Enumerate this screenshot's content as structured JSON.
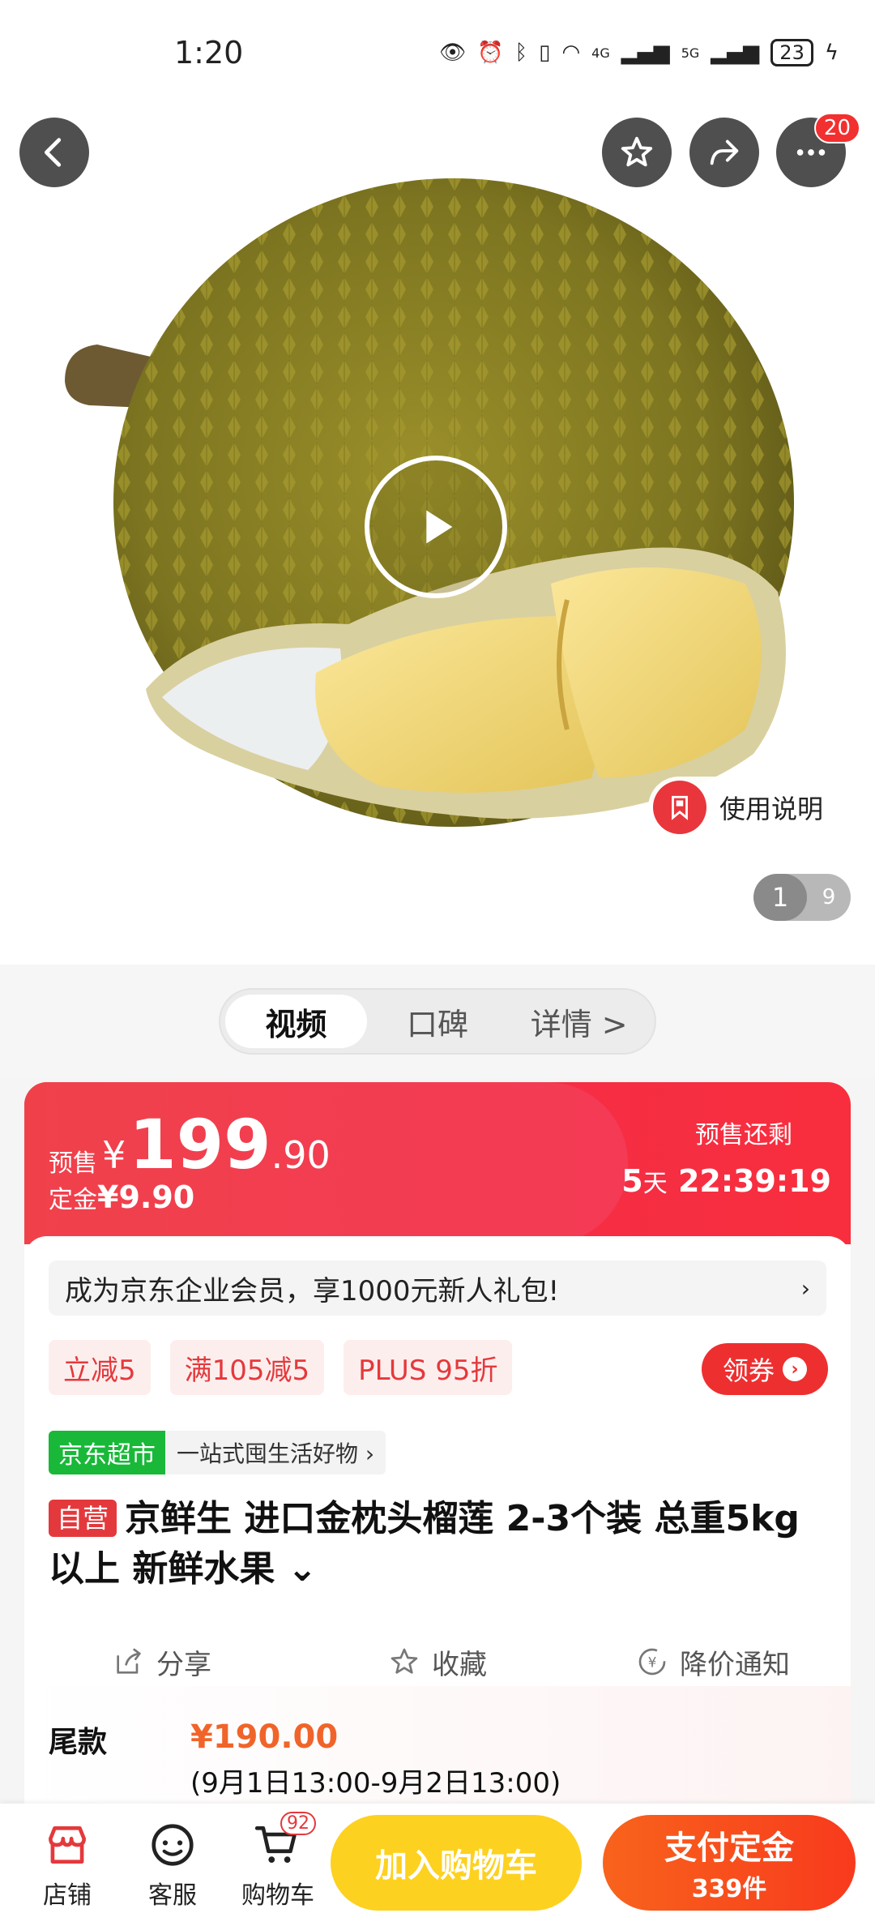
{
  "status": {
    "time": "1:20",
    "network_a": "4G",
    "network_b": "5G",
    "battery": "23"
  },
  "header": {
    "more_badge": "20"
  },
  "hero": {
    "instructions_label": "使用说明",
    "pager_current": "1",
    "pager_total": "9"
  },
  "media_tabs": [
    {
      "label": "视频",
      "active": true
    },
    {
      "label": "口碑",
      "active": false
    },
    {
      "label": "详情 >",
      "active": false
    }
  ],
  "price": {
    "presale_label": "预售",
    "currency": "¥",
    "integer": "199",
    "decimal": ".90",
    "deposit_label": "定金",
    "deposit_value": "¥9.90",
    "countdown_label": "预售还剩",
    "countdown_days": "5",
    "countdown_day_unit": "天",
    "countdown_time": "22:39:19"
  },
  "member_banner": {
    "text": "成为京东企业会员，享1000元新人礼包!",
    "chevron": "›"
  },
  "promos": [
    "立减5",
    "满105减5",
    "PLUS 95折"
  ],
  "coupon_button": {
    "label": "领券",
    "icon": "›"
  },
  "store": {
    "tag": "京东超市",
    "slogan": "一站式囤生活好物 ›"
  },
  "product": {
    "self_tag": "自营",
    "title": "京鲜生 进口金枕头榴莲 2-3个装 总重5kg以上 新鲜水果 ⌄"
  },
  "actions": [
    {
      "name": "share",
      "label": "分享"
    },
    {
      "name": "favorite",
      "label": "收藏"
    },
    {
      "name": "price-alert",
      "label": "降价通知"
    }
  ],
  "balance": {
    "label": "尾款",
    "price": "¥190.00",
    "period": "(9月1日13:00-9月2日13:00)"
  },
  "bottom_bar": {
    "store_label": "店铺",
    "service_label": "客服",
    "cart_label": "购物车",
    "cart_count": "92",
    "add_to_cart": "加入购物车",
    "pay_deposit": "支付定金",
    "pay_count": "339件"
  },
  "colors": {
    "brand_red": "#e4393c",
    "price_band": "#f43f4e",
    "add_cart_yellow": "#fdd11f",
    "pay_orange": "#f8631c",
    "store_green": "#19b839"
  }
}
